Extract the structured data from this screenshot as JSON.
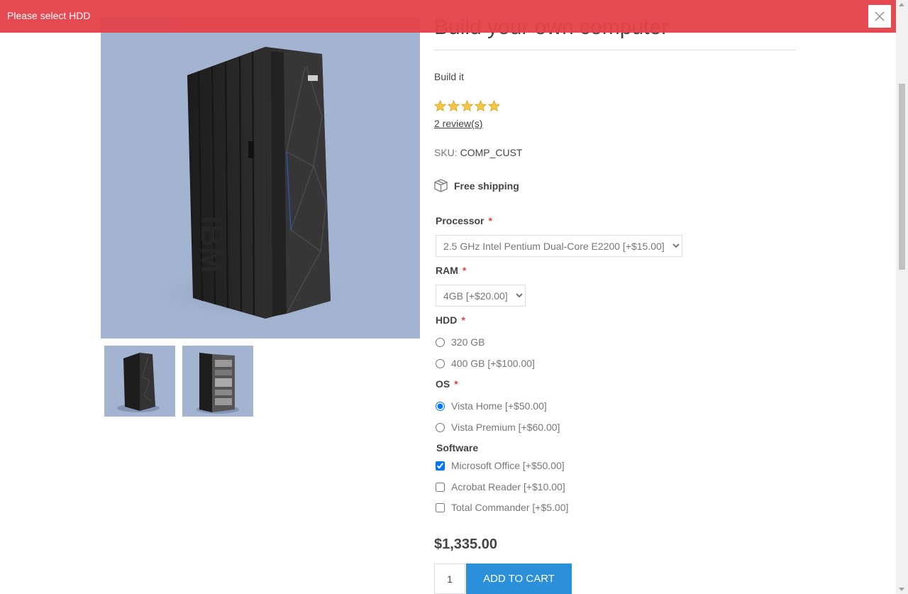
{
  "notification": {
    "message": "Please select HDD",
    "close_icon": "close-icon",
    "color": "#e4434b"
  },
  "product": {
    "title": "Build your own computer",
    "short_description": "Build it",
    "rating": 5,
    "rating_max": 5,
    "reviews_link": "2 review(s)",
    "sku_label": "SKU:",
    "sku_value": "COMP_CUST",
    "shipping_icon": "box-icon",
    "shipping_text": "Free shipping",
    "price": "$1,335.00"
  },
  "attributes": {
    "processor": {
      "label": "Processor",
      "required_mark": "*",
      "selected": "2.5 GHz Intel Pentium Dual-Core E2200 [+$15.00]"
    },
    "ram": {
      "label": "RAM",
      "required_mark": "*",
      "selected": "4GB [+$20.00]"
    },
    "hdd": {
      "label": "HDD",
      "required_mark": "*",
      "options": [
        "320 GB",
        "400 GB [+$100.00]"
      ]
    },
    "os": {
      "label": "OS",
      "required_mark": "*",
      "options": [
        "Vista Home [+$50.00]",
        "Vista Premium [+$60.00]"
      ],
      "selected_index": 0
    },
    "software": {
      "label": "Software",
      "options": [
        "Microsoft Office [+$50.00]",
        "Acrobat Reader [+$10.00]",
        "Total Commander [+$5.00]"
      ],
      "checked": [
        true,
        false,
        false
      ]
    }
  },
  "cart": {
    "quantity": "1",
    "add_to_cart_label": "ADD TO CART",
    "button_color": "#2b90d9"
  },
  "images": {
    "main_image": "ibm-mainframe-image",
    "thumbnails": [
      "ibm-mainframe-thumbnail",
      "ibm-mainframe-open-thumbnail"
    ]
  }
}
